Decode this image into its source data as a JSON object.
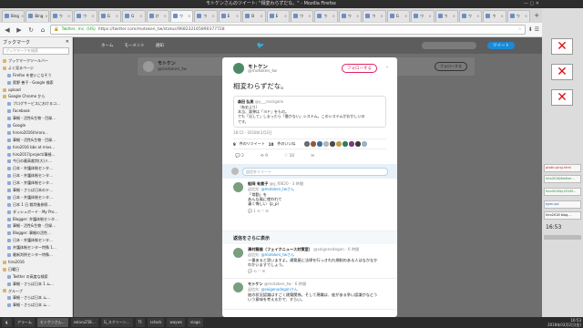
{
  "window": {
    "title": "モトケンさんのツイート: \"相変わらずだな。\" - Mozilla Firefox",
    "controls": "— ▢ ✕"
  },
  "tabs": [
    {
      "label": "Bing"
    },
    {
      "label": "Bing"
    },
    {
      "label": "ウ"
    },
    {
      "label": "ウ"
    },
    {
      "label": "G"
    },
    {
      "label": "G"
    },
    {
      "label": "け"
    },
    {
      "label": "ウ"
    },
    {
      "label": "ウ"
    },
    {
      "label": "E"
    },
    {
      "label": "B"
    },
    {
      "label": "E"
    },
    {
      "label": "ウ"
    },
    {
      "label": "ウ"
    },
    {
      "label": "ウ"
    },
    {
      "label": "ウ"
    },
    {
      "label": "G"
    },
    {
      "label": "ウ"
    },
    {
      "label": "ウ"
    },
    {
      "label": "ウ"
    },
    {
      "label": "ウ"
    },
    {
      "label": "ウ"
    }
  ],
  "navbar": {
    "back": "◀",
    "forward": "▶",
    "reload": "↻",
    "home": "⌂",
    "site": "Twitter, Inc. (US)",
    "url": "https://twitter.com/motoken_tw/status/968232165890377728",
    "star": "☆",
    "right_icons": "⬇ ☰"
  },
  "sidebar": {
    "title": "ブックマーク",
    "close": "✕",
    "search_placeholder": "ブックマークを検索",
    "items": [
      {
        "label": "ブックマークツールバー",
        "folder": true
      },
      {
        "label": "よく見るページ",
        "folder": true
      },
      {
        "label": "Firefox を使いこなそう",
        "folder": false
      },
      {
        "label": "奥野 善子 - Google 検索",
        "folder": false
      },
      {
        "label": "upload",
        "folder": true
      },
      {
        "label": "Google Chrome から",
        "folder": true
      },
      {
        "label": "ブログサービスにおけるコ…",
        "folder": false
      },
      {
        "label": "Facebook",
        "folder": false
      },
      {
        "label": "事細・活性&生物 - 目録…",
        "folder": false
      },
      {
        "label": "Google",
        "folder": false
      },
      {
        "label": "hiroro2016(hiroro…",
        "folder": false
      },
      {
        "label": "事細・活性&生物 - 目録…",
        "folder": false
      },
      {
        "label": "hiro2016 bbs at mixs…",
        "folder": false
      },
      {
        "label": "hiro2017/project/事細…",
        "folder": false
      },
      {
        "label": "今日の最高裁判(大)ミ…",
        "folder": false
      },
      {
        "label": "日本・弁護体制センタ…",
        "folder": false
      },
      {
        "label": "日本・弁護体制センタ…",
        "folder": false
      },
      {
        "label": "日本・弁護体制センタ…",
        "folder": false
      },
      {
        "label": "事細・さらば日本のテ…",
        "folder": false
      },
      {
        "label": "日本・弁護体制センタ…",
        "folder": false
      },
      {
        "label": "日本 1 日 裁判後参照…",
        "folder": false
      },
      {
        "label": "ダッシュボード - My Pro…",
        "folder": false
      },
      {
        "label": "Blogger: 弁護体制センタ…",
        "folder": false
      },
      {
        "label": "事細・活性&生物 - 目録…",
        "folder": false
      },
      {
        "label": "Blogger: 事細の活性…",
        "folder": false
      },
      {
        "label": "日本・弁護体制センタ…",
        "folder": false
      },
      {
        "label": "弁護体制センター特殊 1…",
        "folder": false
      },
      {
        "label": "最新判例センター特殊…",
        "folder": false
      },
      {
        "label": "hiro2016",
        "folder": true
      },
      {
        "label": "日曜日",
        "folder": true
      },
      {
        "label": "Twitter の高度な検索",
        "folder": false
      },
      {
        "label": "事細・さらば日本 1 ム…",
        "folder": false
      },
      {
        "label": "グループ",
        "folder": true
      },
      {
        "label": "事細・さらば日本 ム…",
        "folder": false
      },
      {
        "label": "事細・さらば日本 ム…",
        "folder": false
      }
    ]
  },
  "twitter_header": {
    "home": "ホーム",
    "moments": "モーメント",
    "notifications": "通知",
    "bird": "🐦",
    "tweet_button": "ツイート"
  },
  "profile_card": {
    "name": "モトケン",
    "handle": "@motoken_tw",
    "follow": "フォローする"
  },
  "tweet": {
    "author_name": "モトケン",
    "author_handle": "@motoken_tw",
    "follow_button": "フォローする",
    "text": "相変わらずだな。",
    "quote": {
      "name": "森田 弘美",
      "handle": "@y___morigami",
      "lines": [
        "（有史より）",
        "本当、悪弾は「ヨド」をもの。",
        "でも「出して」しまったら「働かない」システム。このシステムがおかしいの",
        "です。"
      ]
    },
    "time": "18:15 - 2018年3月2日",
    "retweets_label": "件のリツイート",
    "retweets_count": "9",
    "likes_label": "件のいいね",
    "likes_count": "10",
    "avatar_colors": [
      "#6b6b6b",
      "#8a5a3a",
      "#3a6e9e",
      "#b5b5b5",
      "#4a4a4a",
      "#c79a4a",
      "#2e7d5b",
      "#7a3a7a",
      "#3a3a3a",
      "#9bb0c9"
    ],
    "actions": {
      "reply": "💬 2",
      "retweet": "⟲ 9",
      "like": "♡ 10",
      "dm": "✉"
    }
  },
  "reply_box": {
    "placeholder": "返信をツイート"
  },
  "replies": [
    {
      "name": "船岡 有貴子",
      "handle": "@y_f0620",
      "time": "· 3 時間",
      "to_prefix": "返信先:",
      "to": "@motoken_twさん",
      "lines": [
        "「常勤」を",
        "あんな風に使われて",
        "凄く悔しい（p_p）"
      ],
      "actions": "💬 1  ⟲  ♡  ✉"
    },
    {
      "name": "清村龍雄（フェイクニュース対策室）",
      "handle": "@seigenodegon",
      "time": "· 6 時間",
      "to_prefix": "返信先:",
      "to": "@motoken_twさん",
      "lines": [
        "一番あると思いますよ。建築屋に法律を行っきれれ規制のある人はなかなか",
        "わかいますでしょう。"
      ],
      "actions": "💬  ⟲  ♡  ✉"
    },
    {
      "name": "モトケン",
      "handle": "@motoken_tw",
      "time": "· 6 時間",
      "to_prefix": "返信先:",
      "to": "@seigenodegonさん",
      "lines": [
        "彼の状況認識はすごく建築関係。そして現職は、彼がある争い認識がなどう",
        "いう意味を考えるかで、すらい。"
      ],
      "actions": ""
    }
  ],
  "more_replies": "返信をさらに表示",
  "taskbar": {
    "items": [
      "🐧",
      "アラーム",
      "モトケンさん…",
      "seiaru258…",
      "G_スクリーン…",
      "Tt",
      "sctock",
      "wayws",
      "viogo"
    ],
    "time": "16:53",
    "date": "2018年03月2日(金)"
  },
  "right_panel": {
    "notes": [
      "ptatic.ping.html",
      "hiro2018/twitter…",
      "hiro2016ty.2018f…",
      "tgrm.spl",
      "hiro2018 blog…"
    ],
    "time": "16:53"
  },
  "colors": {
    "accent": "#1b8ad8",
    "follow": "#e0245e",
    "overlay": "#6e6e6e"
  }
}
